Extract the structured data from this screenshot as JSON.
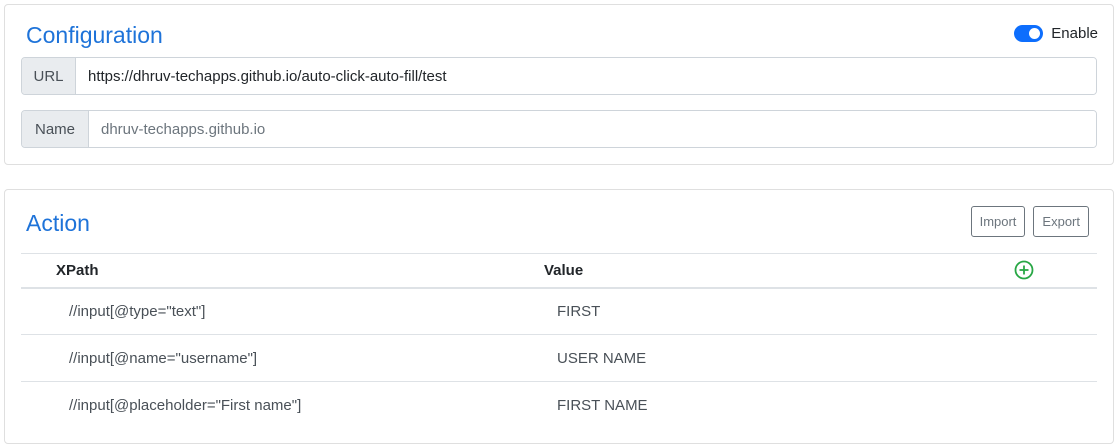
{
  "configuration": {
    "title": "Configuration",
    "toggle_label": "Enable",
    "enabled": true,
    "url_label": "URL",
    "url_value": "https://dhruv-techapps.github.io/auto-click-auto-fill/test",
    "name_label": "Name",
    "name_placeholder": "dhruv-techapps.github.io"
  },
  "action": {
    "title": "Action",
    "import_label": "Import",
    "export_label": "Export",
    "columns": {
      "xpath": "XPath",
      "value": "Value"
    },
    "rows": [
      {
        "xpath": "//input[@type=\"text\"]",
        "value": "FIRST"
      },
      {
        "xpath": "//input[@name=\"username\"]",
        "value": "USER NAME"
      },
      {
        "xpath": "//input[@placeholder=\"First name\"]",
        "value": "FIRST NAME"
      }
    ]
  },
  "colors": {
    "accent": "#1e73d9",
    "toggle": "#0d6efd",
    "add_icon": "#28a745"
  }
}
